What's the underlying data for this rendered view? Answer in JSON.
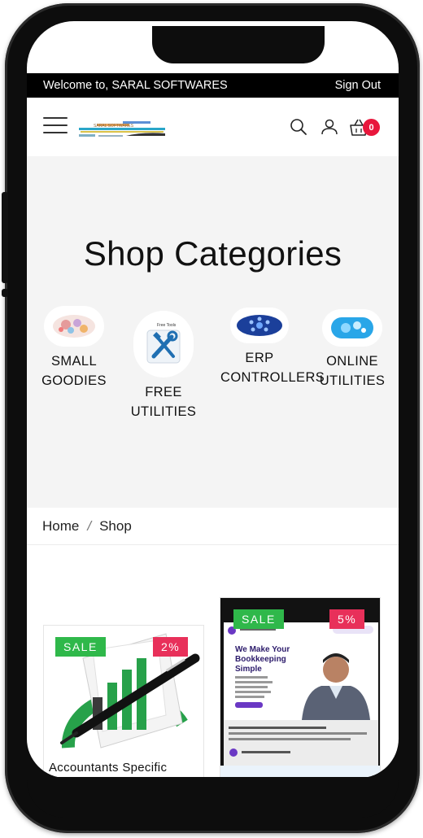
{
  "topbar": {
    "welcome": "Welcome to, SARAL SOFTWARES",
    "signout": "Sign Out"
  },
  "header": {
    "menu_icon": "hamburger-menu-icon",
    "logo_text": "SARAL SOFTWARES",
    "cart_count": "0"
  },
  "categories": {
    "title": "Shop Categories",
    "items": [
      {
        "label": "SMALL\nGOODIES"
      },
      {
        "label": "FREE\nUTILITIES"
      },
      {
        "label": "ERP\nCONTROLLERS"
      },
      {
        "label": "ONLINE\nUTILITIES"
      }
    ]
  },
  "breadcrumb": {
    "home": "Home",
    "current": "Shop"
  },
  "products": [
    {
      "title": "Accountants Specific",
      "sale": "SALE",
      "discount": "2%"
    },
    {
      "title": "",
      "sale": "SALE",
      "discount": "5%"
    }
  ],
  "promo": {
    "headline": "We Make Your Bookkeeping Simple"
  },
  "colors": {
    "sale": "#2fb84a",
    "discount": "#e8305a",
    "badge": "#e8173c",
    "topbar": "#000000",
    "section_bg": "#f4f4f4"
  }
}
